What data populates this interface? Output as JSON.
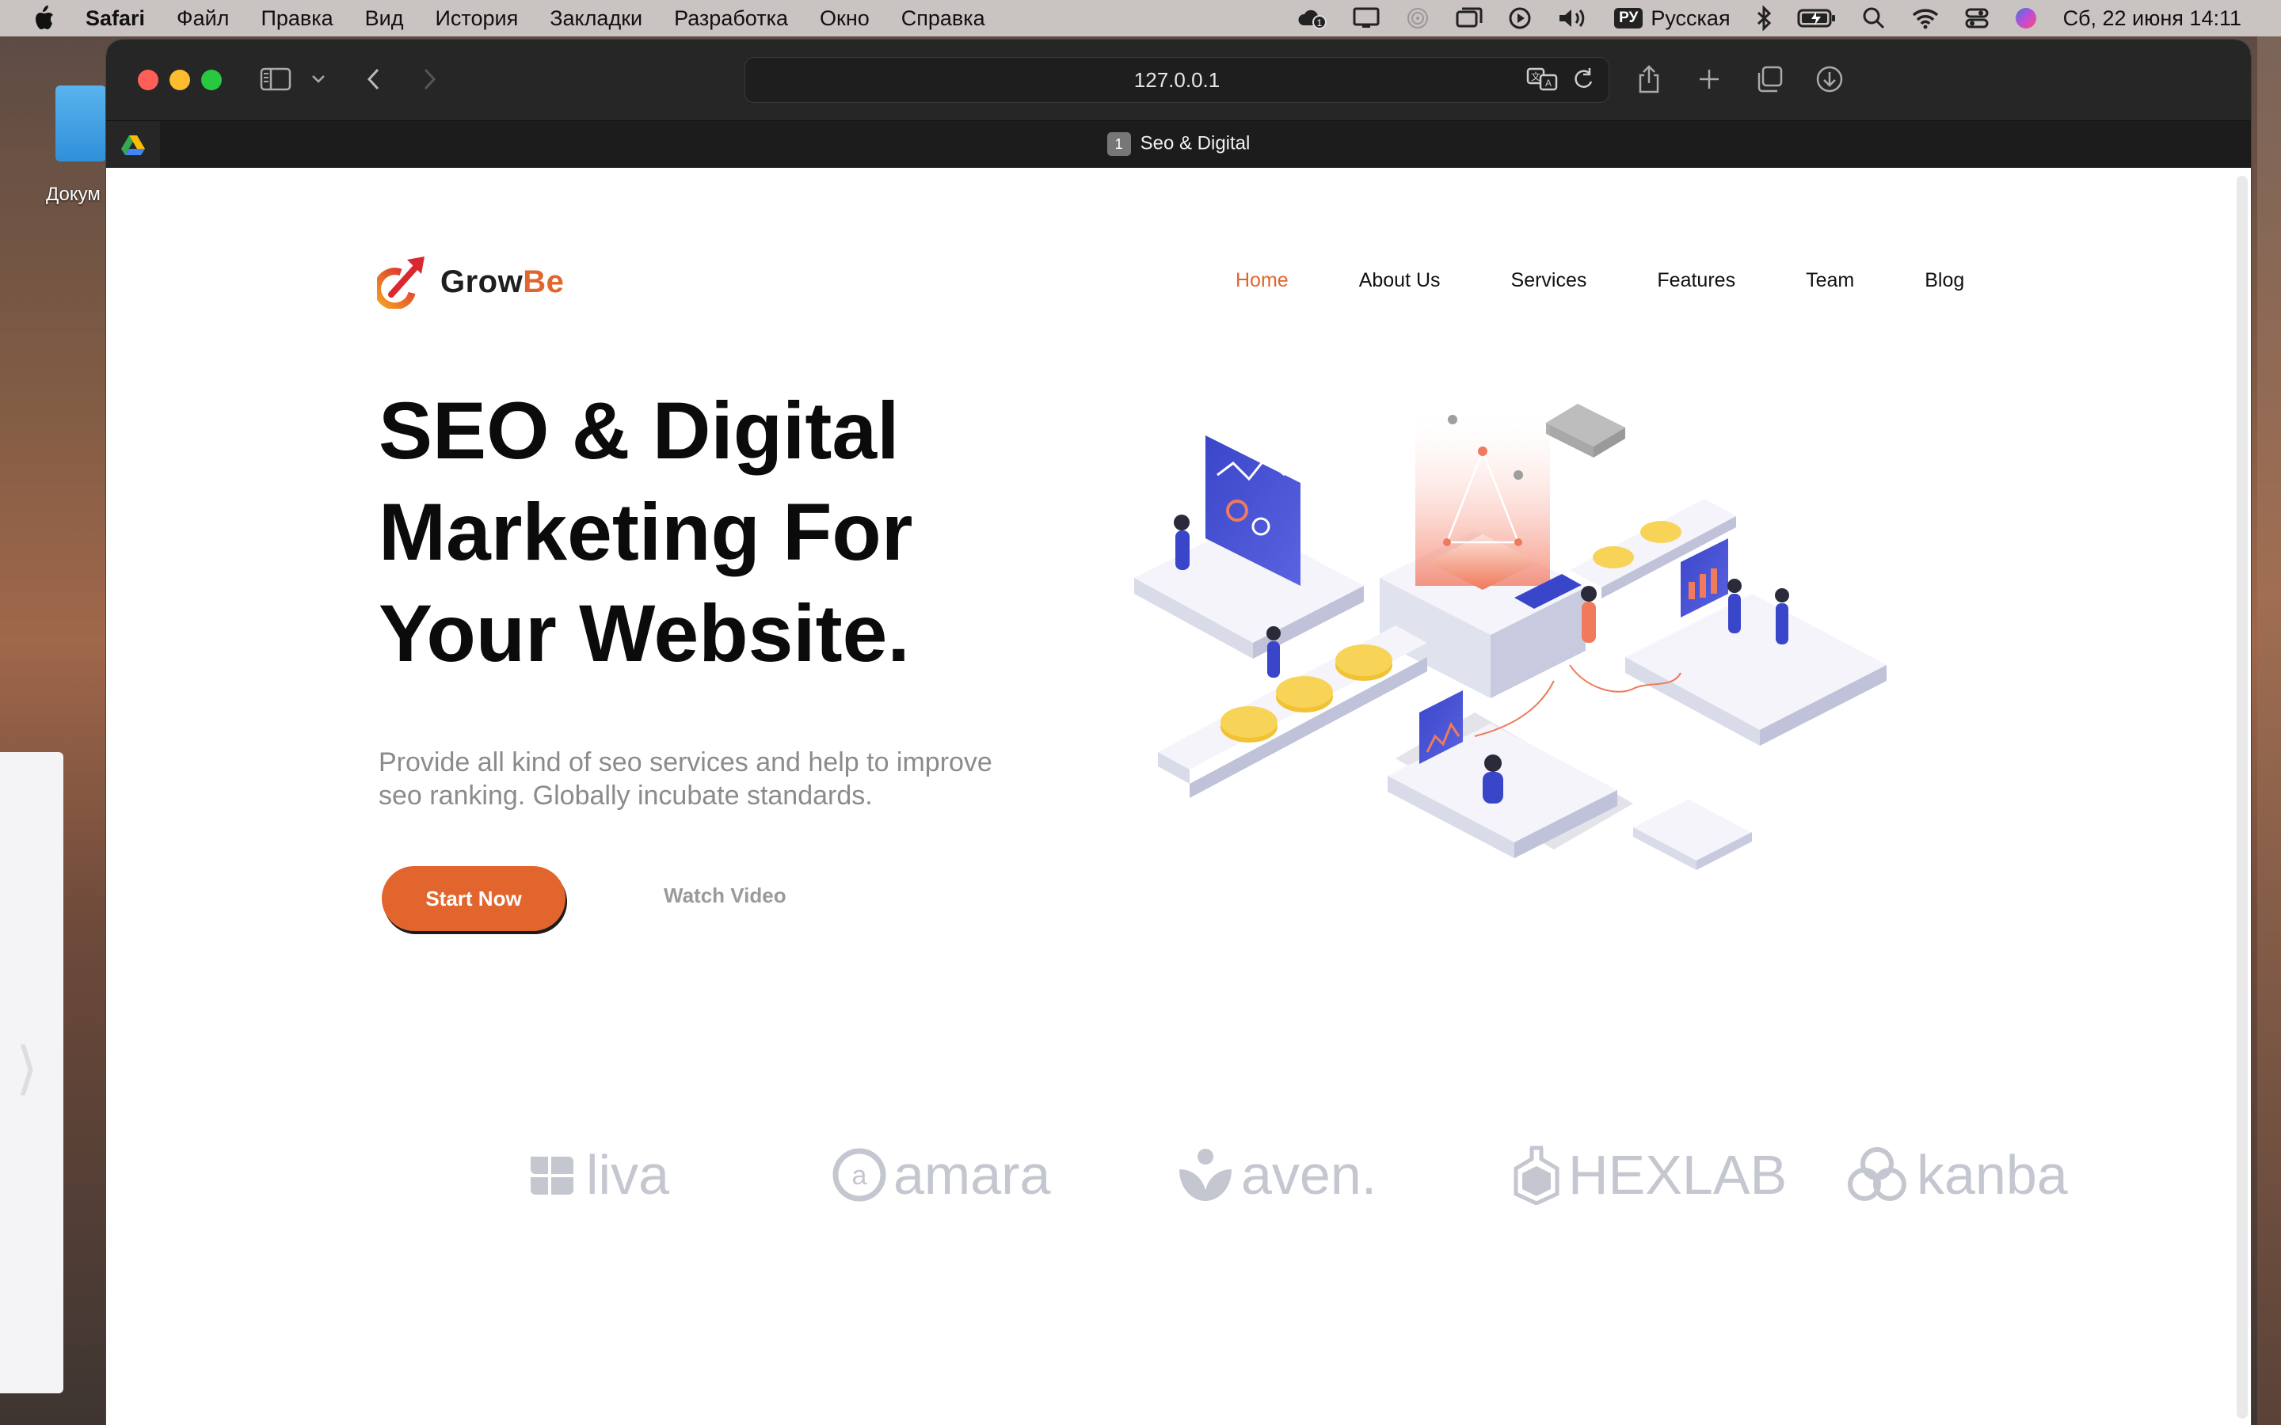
{
  "menubar": {
    "app_name": "Safari",
    "items": [
      "Файл",
      "Правка",
      "Вид",
      "История",
      "Закладки",
      "Разработка",
      "Окно",
      "Справка"
    ],
    "input_badge": "РУ",
    "input_language": "Русская",
    "datetime": "Сб, 22 июня  14:11"
  },
  "desktop": {
    "folder_label": "Докум"
  },
  "browser": {
    "address": "127.0.0.1",
    "tab_number": "1",
    "tab_title": "Seo & Digital"
  },
  "site": {
    "logo_main": "Grow",
    "logo_accent": "Be",
    "nav": [
      {
        "label": "Home",
        "active": true
      },
      {
        "label": "About Us",
        "active": false
      },
      {
        "label": "Services",
        "active": false
      },
      {
        "label": "Features",
        "active": false
      },
      {
        "label": "Team",
        "active": false
      },
      {
        "label": "Blog",
        "active": false
      }
    ],
    "hero": {
      "title_line1": "SEO & Digital",
      "title_line2": "Marketing For",
      "title_line3": "Your Website.",
      "subtitle": "Provide all kind of seo services and help to improve seo ranking. Globally incubate standards.",
      "primary_button": "Start Now",
      "secondary_button": "Watch Video"
    },
    "brands": [
      "liva",
      "amara",
      "aven.",
      "HEXLAB",
      "kanba"
    ],
    "colors": {
      "accent": "#e2652e",
      "text_dark": "#0b0b0b",
      "text_muted": "#8b8b8b",
      "brand_grey": "#c4c6d0"
    }
  }
}
